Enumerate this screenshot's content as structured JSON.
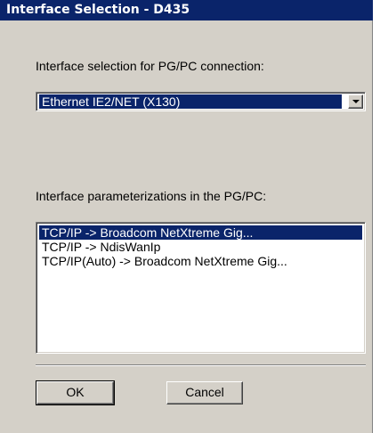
{
  "window": {
    "title": "Interface Selection - D435"
  },
  "interface_selection": {
    "label": "Interface selection for PG/PC connection:",
    "selected_value": "Ethernet IE2/NET (X130)"
  },
  "parameterizations": {
    "label": "Interface parameterizations in the PG/PC:",
    "items": [
      {
        "label": "TCP/IP -> Broadcom NetXtreme Gig...",
        "selected": true
      },
      {
        "label": "TCP/IP -> NdisWanIp",
        "selected": false
      },
      {
        "label": "TCP/IP(Auto) -> Broadcom NetXtreme Gig...",
        "selected": false
      }
    ]
  },
  "buttons": {
    "ok_label": "OK",
    "cancel_label": "Cancel"
  },
  "colors": {
    "titlebar": "#0a246a",
    "selection": "#0a246a",
    "dialog_face": "#d4d0c8"
  }
}
